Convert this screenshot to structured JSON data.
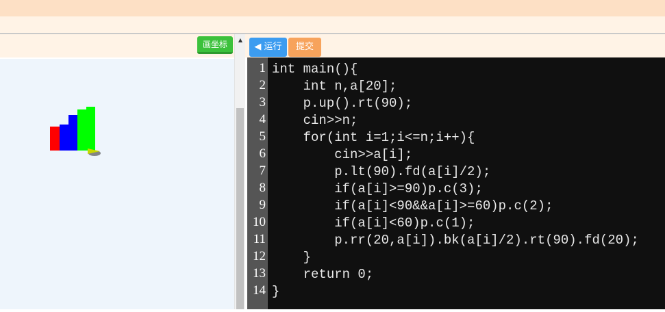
{
  "left_panel": {
    "draw_axes_label": "画坐标",
    "turtle_colors": [
      "#ff0000",
      "#0000ff",
      "#00ff00"
    ]
  },
  "toolbar": {
    "run_label": "◀ 运行",
    "submit_label": "提交"
  },
  "editor": {
    "line_numbers": [
      "1",
      "2",
      "3",
      "4",
      "5",
      "6",
      "7",
      "8",
      "9",
      "10",
      "11",
      "12",
      "13",
      "14"
    ],
    "code_lines": [
      "int main(){",
      "    int n,a[20];",
      "    p.up().rt(90);",
      "    cin>>n;",
      "    for(int i=1;i<=n;i++){",
      "        cin>>a[i];",
      "        p.lt(90).fd(a[i]/2);",
      "        if(a[i]>=90)p.c(3);",
      "        if(a[i]<90&&a[i]>=60)p.c(2);",
      "        if(a[i]<60)p.c(1);",
      "        p.rr(20,a[i]).bk(a[i]/2).rt(90).fd(20);",
      "    }",
      "    return 0;",
      "}"
    ]
  }
}
